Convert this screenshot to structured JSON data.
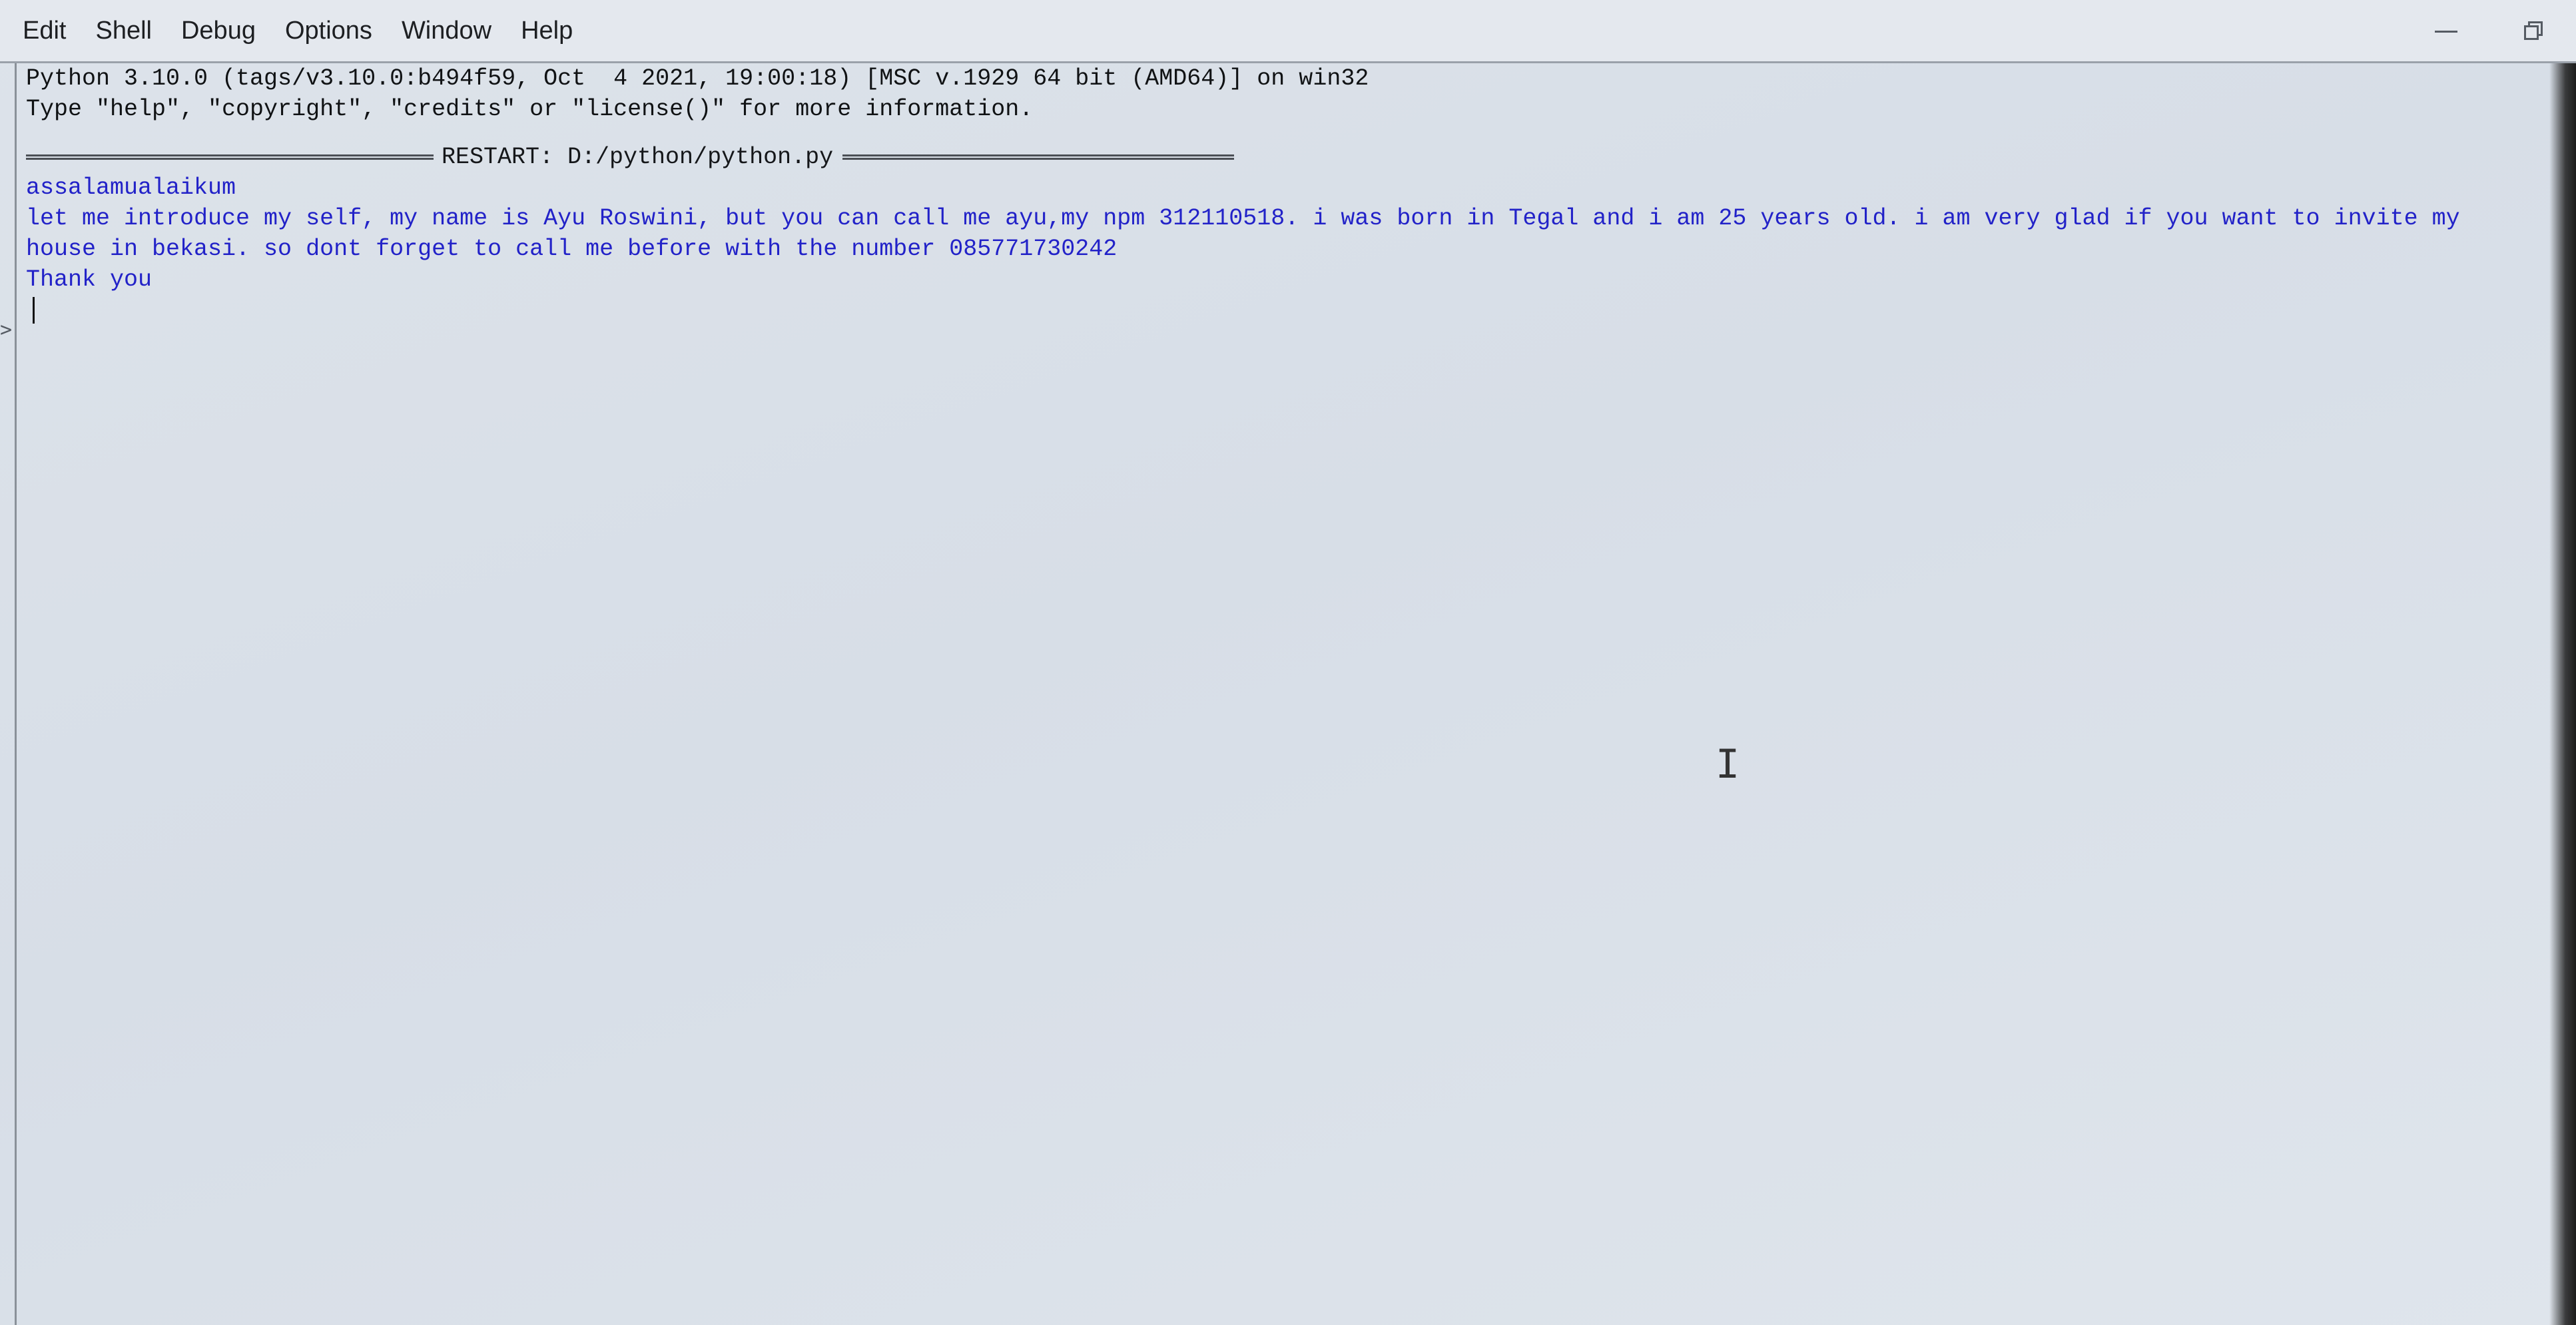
{
  "menu": {
    "items": [
      {
        "label": "Edit"
      },
      {
        "label": "Shell"
      },
      {
        "label": "Debug"
      },
      {
        "label": "Options"
      },
      {
        "label": "Window"
      },
      {
        "label": "Help"
      }
    ]
  },
  "window_controls": {
    "minimize_icon": "minimize-icon",
    "restore_icon": "restore-icon"
  },
  "shell": {
    "banner_line1": "Python 3.10.0 (tags/v3.10.0:b494f59, Oct  4 2021, 19:00:18) [MSC v.1929 64 bit (AMD64)] on win32",
    "banner_line2": "Type \"help\", \"copyright\", \"credits\" or \"license()\" for more information.",
    "restart_text": "RESTART: D:/python/python.py",
    "output": [
      "assalamualaikum",
      "let me introduce my self, my name is Ayu Roswini, but you can call me ayu,my npm 312110518. i was born in Tegal and i am 25 years old. i am very glad if you want to invite my house in bekasi. so dont forget to call me before with the number 085771730242",
      "Thank you"
    ],
    "prompt": ">",
    "colors": {
      "output": "#2222c8",
      "text": "#101214"
    }
  }
}
